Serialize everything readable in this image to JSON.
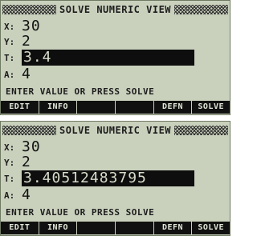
{
  "screens": [
    {
      "title": "SOLVE NUMERIC VIEW",
      "variables": [
        {
          "name": "X:",
          "value": "30"
        },
        {
          "name": "Y:",
          "value": "2"
        },
        {
          "name": "T:",
          "value": "3.4"
        },
        {
          "name": "A:",
          "value": "4"
        }
      ],
      "status": "ENTER VALUE OR PRESS SOLVE",
      "softkeys": [
        "EDIT",
        "INFO",
        "",
        "",
        "DEFN",
        "SOLVE"
      ]
    },
    {
      "title": "SOLVE NUMERIC VIEW",
      "variables": [
        {
          "name": "X:",
          "value": "30"
        },
        {
          "name": "Y:",
          "value": "2"
        },
        {
          "name": "T:",
          "value": "3.40512483795"
        },
        {
          "name": "A:",
          "value": "4"
        }
      ],
      "status": "ENTER VALUE OR PRESS SOLVE",
      "softkeys": [
        "EDIT",
        "INFO",
        "",
        "",
        "DEFN",
        "SOLVE"
      ]
    }
  ],
  "colors": {
    "lcd_background": "#c9d1bd",
    "lcd_ink": "#111111",
    "softkey_background": "#101010"
  }
}
